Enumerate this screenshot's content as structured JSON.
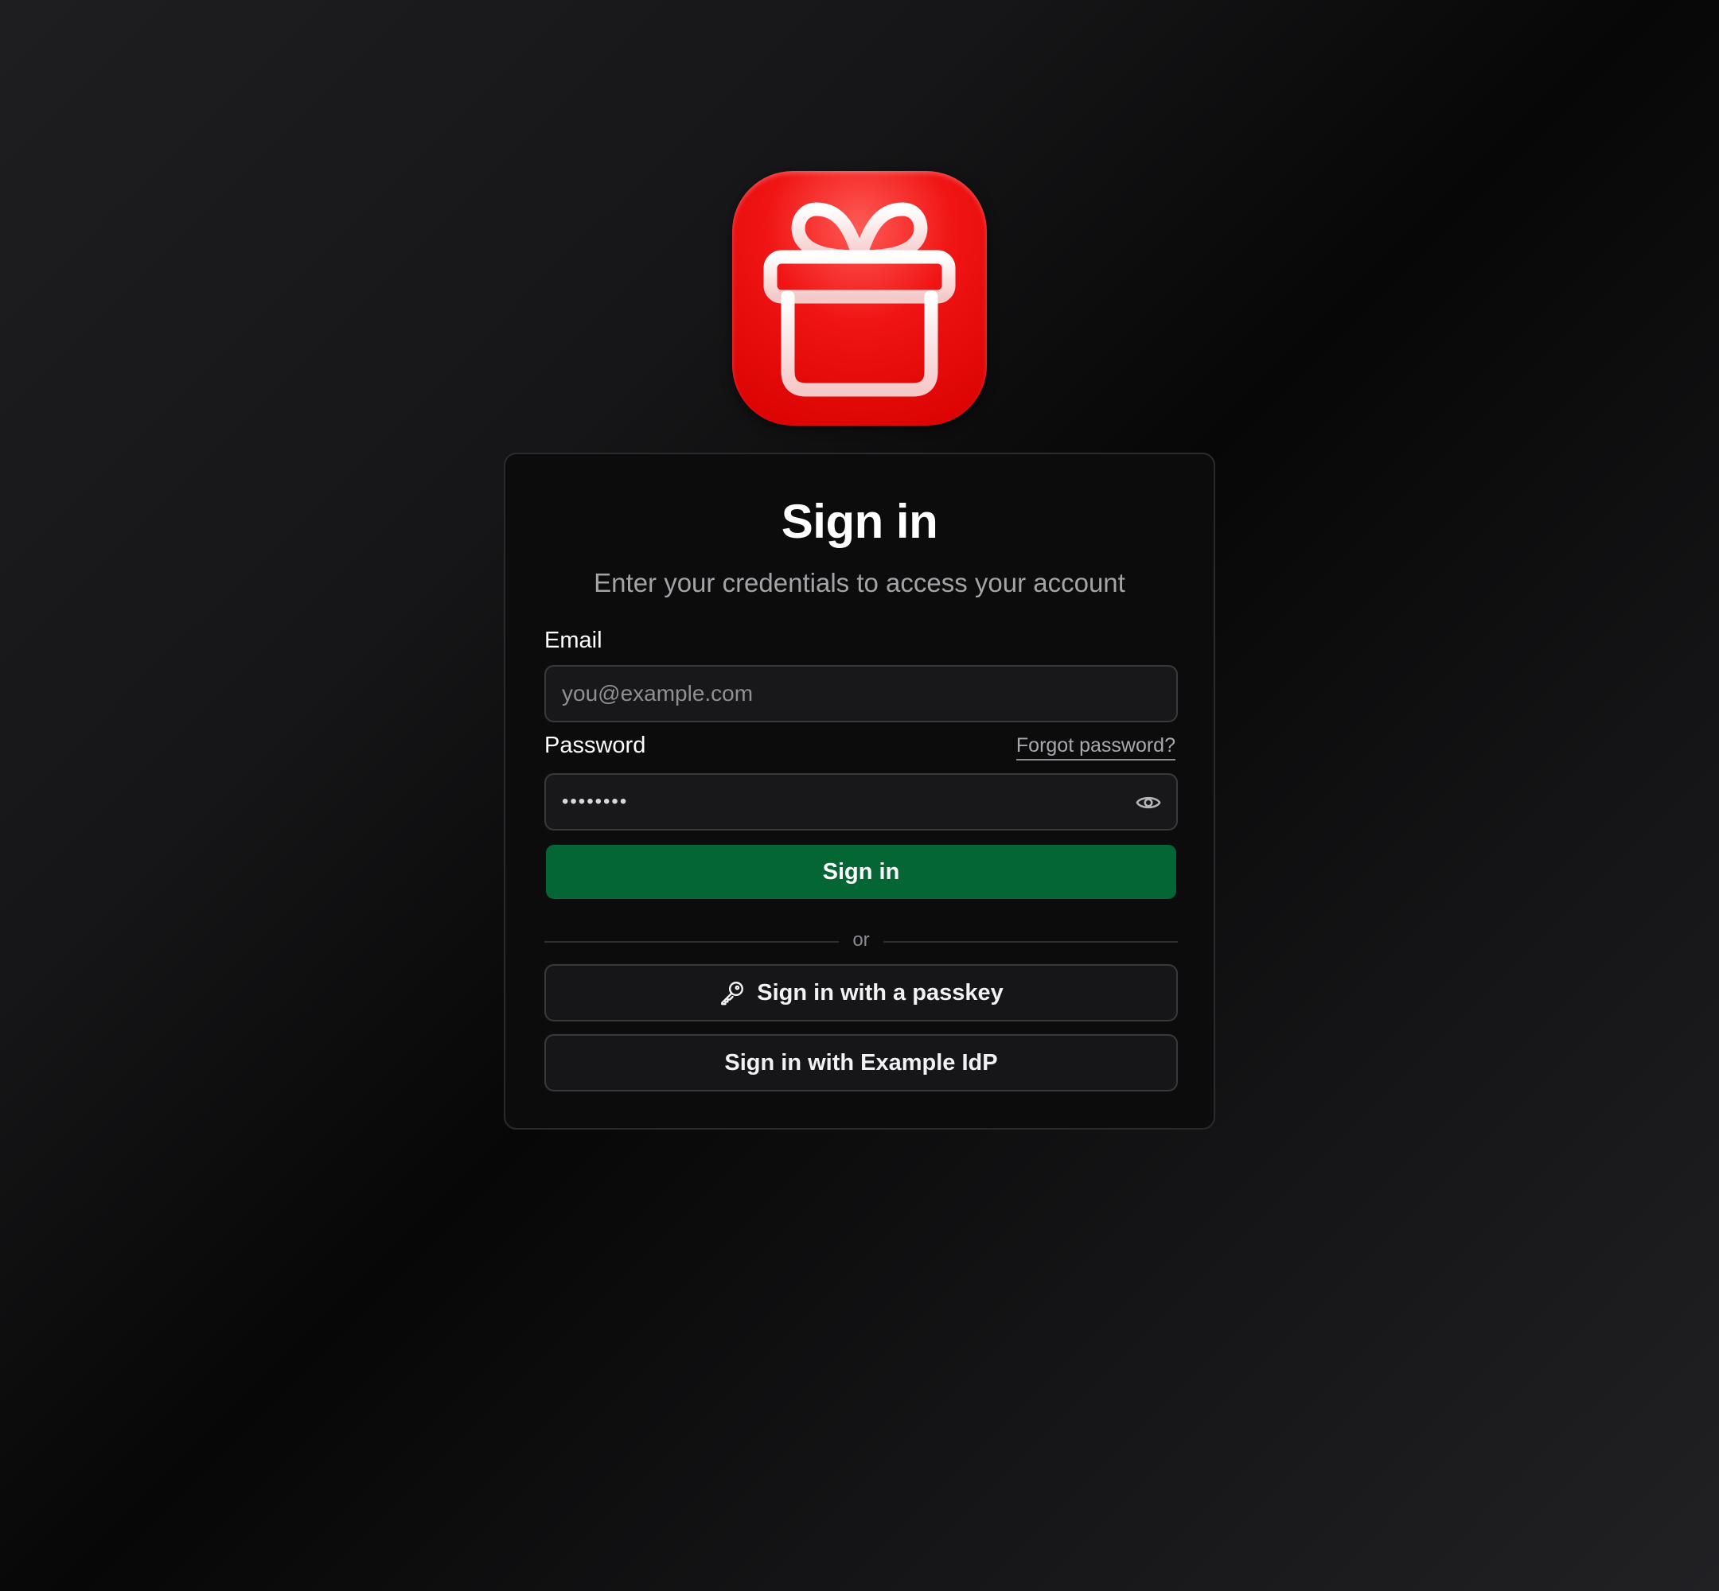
{
  "app": {
    "logo_icon": "gift-icon",
    "brand_color": "#e50000"
  },
  "card": {
    "title": "Sign in",
    "subtitle": "Enter your credentials to access your account"
  },
  "form": {
    "email_label": "Email",
    "email_placeholder": "you@example.com",
    "email_value": "",
    "password_label": "Password",
    "password_value": "••••••••",
    "forgot_link": "Forgot password?",
    "show_password_icon": "eye-icon",
    "submit_label": "Sign in",
    "submit_color": "#036634"
  },
  "alternatives": {
    "divider_text": "or",
    "passkey_icon": "key-icon",
    "passkey_label": "Sign in with a passkey",
    "idp_label": "Sign in with Example IdP"
  }
}
